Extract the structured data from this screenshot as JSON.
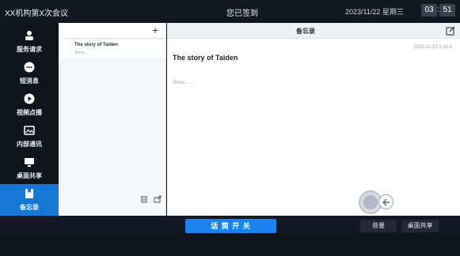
{
  "topbar": {
    "org": "XX机构第X次会议",
    "status": "您已签到",
    "datetime": "2023/11/22 星期三",
    "clock_hour": "03",
    "clock_minute": "51",
    "clock_sep": ":"
  },
  "sidebar": {
    "items": [
      {
        "label": "服务请求",
        "icon": "person-icon"
      },
      {
        "label": "短消息",
        "icon": "chat-icon"
      },
      {
        "label": "视频点播",
        "icon": "play-icon"
      },
      {
        "label": "内部通讯",
        "icon": "photo-icon"
      },
      {
        "label": "桌面共享",
        "icon": "monitor-icon"
      },
      {
        "label": "备忘录",
        "icon": "bookmark-icon",
        "active": true
      }
    ],
    "colors": {
      "active_bg": "#1577d6"
    }
  },
  "list_panel": {
    "add_label": "+",
    "items": [
      {
        "title": "The story of Taiden",
        "preview": "Since....."
      }
    ]
  },
  "main": {
    "header_title": "备忘录",
    "note_title": "The story of Taiden",
    "note_date": "2023-11-22 2:26:6",
    "note_body": "Since......"
  },
  "bottombar": {
    "speak_label": "话 筒 开 关",
    "volume_label": "音量",
    "share_label": "桌面共享",
    "accent": "#1a83ef"
  }
}
